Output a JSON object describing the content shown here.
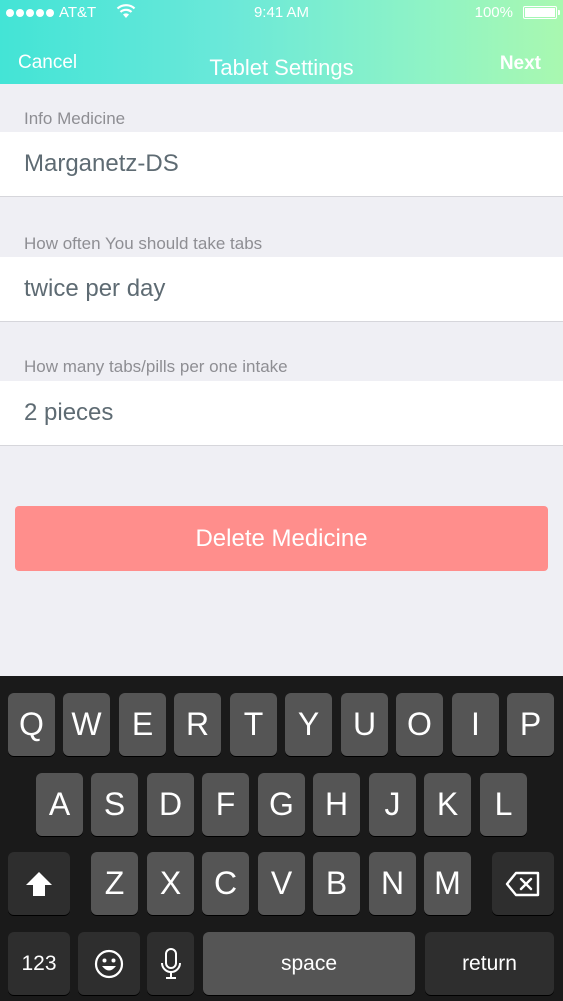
{
  "status_bar": {
    "carrier": "AT&T",
    "time": "9:41 AM",
    "battery": "100%"
  },
  "nav": {
    "left": "Cancel",
    "title": "Tablet Settings",
    "right": "Next"
  },
  "form": {
    "fields": [
      {
        "label": "Info Medicine",
        "value": "Marganetz-DS"
      },
      {
        "label": "How often You should take tabs",
        "value": "twice per day"
      },
      {
        "label": "How many tabs/pills per one intake",
        "value": "2 pieces"
      }
    ],
    "delete_label": "Delete Medicine"
  },
  "keyboard": {
    "row1": [
      "Q",
      "W",
      "E",
      "R",
      "T",
      "Y",
      "U",
      "O",
      "I",
      "P"
    ],
    "row2": [
      "A",
      "S",
      "D",
      "F",
      "G",
      "H",
      "J",
      "K",
      "L"
    ],
    "row3": [
      "Z",
      "X",
      "C",
      "V",
      "B",
      "N",
      "M"
    ],
    "numbers_label": "123",
    "space_label": "space",
    "return_label": "return",
    "icons": [
      "shift-icon",
      "backspace-icon",
      "emoji-icon",
      "microphone-icon"
    ]
  },
  "colors": {
    "header_start": "#43e4d6",
    "header_end": "#a9f8b0",
    "delete": "#ff8e8c"
  }
}
